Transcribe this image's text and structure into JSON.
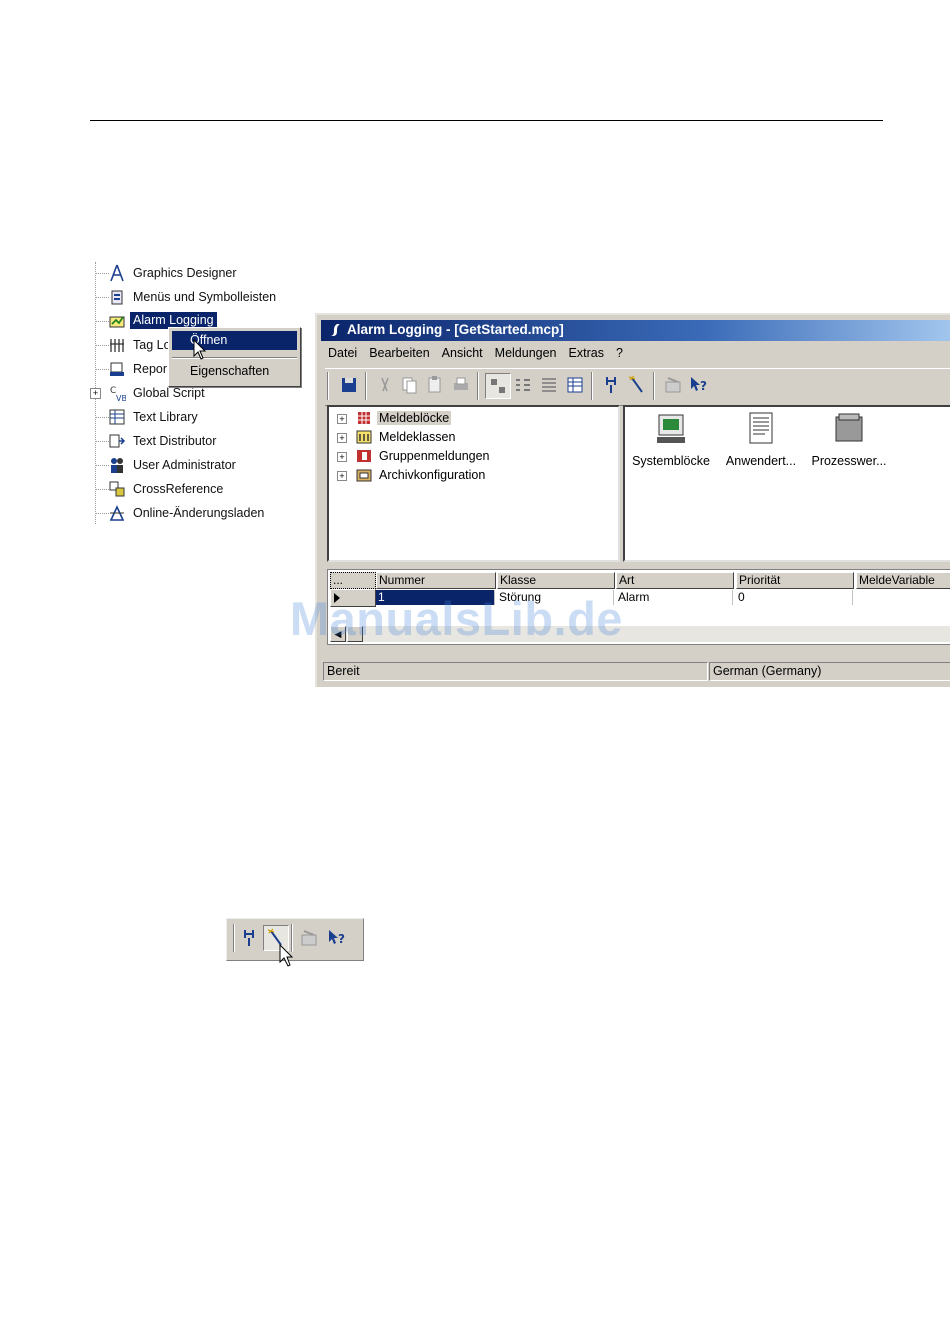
{
  "tree": {
    "items": [
      {
        "label": "Graphics Designer",
        "icon": "graphics-designer-icon"
      },
      {
        "label": "Menüs und Symbolleisten",
        "icon": "menus-toolbars-icon"
      },
      {
        "label": "Alarm Logging",
        "icon": "alarm-logging-icon",
        "selected": true
      },
      {
        "label": "Tag Lo",
        "icon": "tag-logging-icon"
      },
      {
        "label": "Repor",
        "icon": "report-designer-icon"
      },
      {
        "label": "Global Script",
        "icon": "global-script-icon"
      },
      {
        "label": "Text Library",
        "icon": "text-library-icon"
      },
      {
        "label": "Text Distributor",
        "icon": "text-distributor-icon"
      },
      {
        "label": "User Administrator",
        "icon": "user-administrator-icon"
      },
      {
        "label": "CrossReference",
        "icon": "cross-reference-icon"
      },
      {
        "label": "Online-Änderungsladen",
        "icon": "online-change-icon"
      }
    ]
  },
  "context_menu": {
    "open_label": "Öffnen",
    "properties_label": "Eigenschaften"
  },
  "window": {
    "title": "Alarm Logging - [GetStarted.mcp]",
    "menu": [
      "Datei",
      "Bearbeiten",
      "Ansicht",
      "Meldungen",
      "Extras",
      "?"
    ],
    "nav_tree": [
      {
        "label": "Meldeblöcke",
        "icon": "message-blocks-icon"
      },
      {
        "label": "Meldeklassen",
        "icon": "message-classes-icon"
      },
      {
        "label": "Gruppenmeldungen",
        "icon": "group-messages-icon"
      },
      {
        "label": "Archivkonfiguration",
        "icon": "archive-config-icon"
      }
    ],
    "data_objects": [
      {
        "label": "Systemblöcke",
        "icon": "system-blocks-icon"
      },
      {
        "label": "Anwendert...",
        "icon": "user-text-blocks-icon"
      },
      {
        "label": "Prozesswer...",
        "icon": "process-value-blocks-icon"
      }
    ],
    "table": {
      "columns": [
        "...",
        "Nummer",
        "Klasse",
        "Art",
        "Priorität",
        "MeldeVariable"
      ],
      "rows": [
        {
          "nummer": "1",
          "klasse": "Störung",
          "art": "Alarm",
          "prioritaet": "0",
          "meldevariable": ""
        }
      ]
    },
    "status": {
      "left": "Bereit",
      "language": "German (Germany)"
    }
  },
  "watermark": "ManualsLib.de",
  "colors": {
    "selection": "#0a246a",
    "face": "#d4d0c8",
    "titlebar_start": "#0a246a",
    "titlebar_end": "#a6caf0"
  }
}
